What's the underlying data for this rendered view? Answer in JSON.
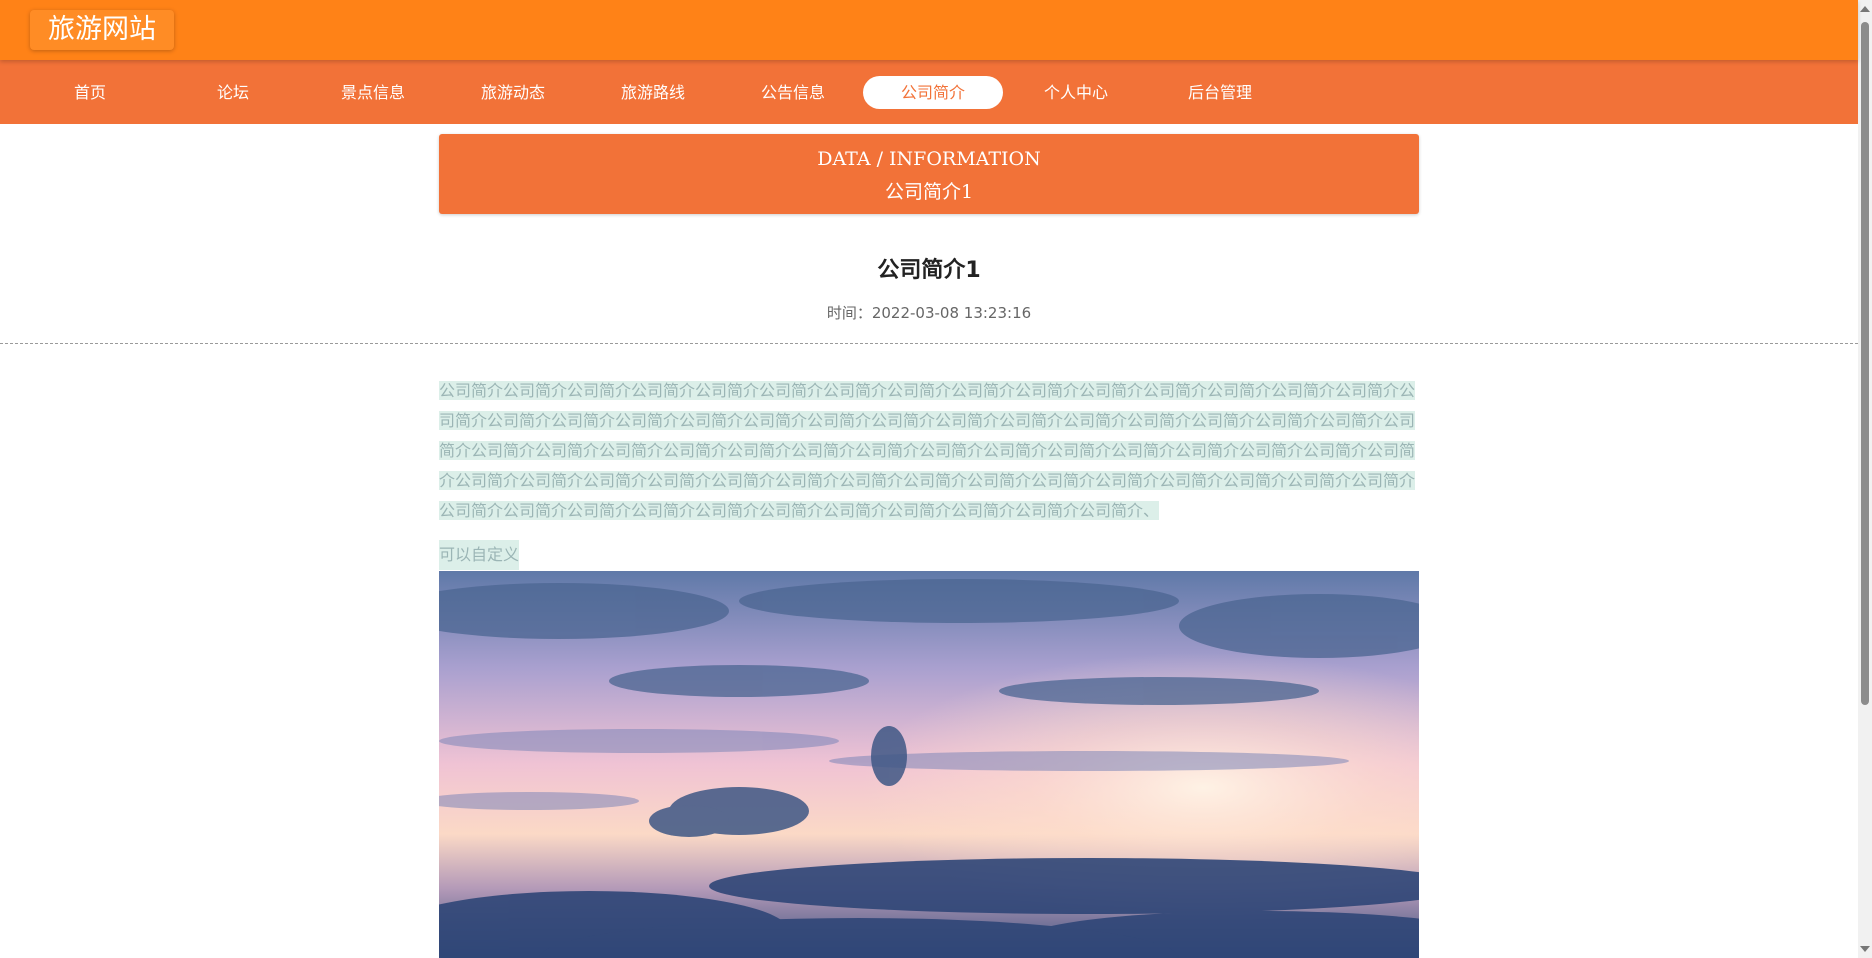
{
  "header": {
    "site_title": "旅游网站"
  },
  "nav": {
    "items": [
      {
        "label": "首页"
      },
      {
        "label": "论坛"
      },
      {
        "label": "景点信息"
      },
      {
        "label": "旅游动态"
      },
      {
        "label": "旅游路线"
      },
      {
        "label": "公告信息"
      },
      {
        "label": "公司简介",
        "active": true
      },
      {
        "label": "个人中心"
      },
      {
        "label": "后台管理"
      }
    ]
  },
  "banner": {
    "english": "DATA / INFORMATION",
    "chinese": "公司简介1"
  },
  "article": {
    "title": "公司简介1",
    "time": "时间：2022-03-08 13:23:16",
    "body": "公司简介公司简介公司简介公司简介公司简介公司简介公司简介公司简介公司简介公司简介公司简介公司简介公司简介公司简介公司简介公司简介公司简介公司简介公司简介公司简介公司简介公司简介公司简介公司简介公司简介公司简介公司简介公司简介公司简介公司简介公司简介公司简介公司简介公司简介公司简介公司简介公司简介公司简介公司简介公司简介公司简介公司简介公司简介公司简介公司简介公司简介公司简介公司简介公司简介公司简介公司简介公司简介公司简介公司简介公司简介公司简介公司简介公司简介公司简介公司简介公司简介公司简介公司简介公司简介公司简介公司简介公司简介公司简介公司简介公司简介公司简介公司简介、",
    "note": "可以自定义"
  },
  "colors": {
    "header_bg": "#ff8217",
    "nav_bg": "#f27238",
    "banner_bg": "#f27238",
    "highlight_bg": "#dcefe9"
  },
  "icons": {
    "scroll_up": "scroll-up-arrow-icon",
    "scroll_down": "scroll-down-arrow-icon"
  }
}
